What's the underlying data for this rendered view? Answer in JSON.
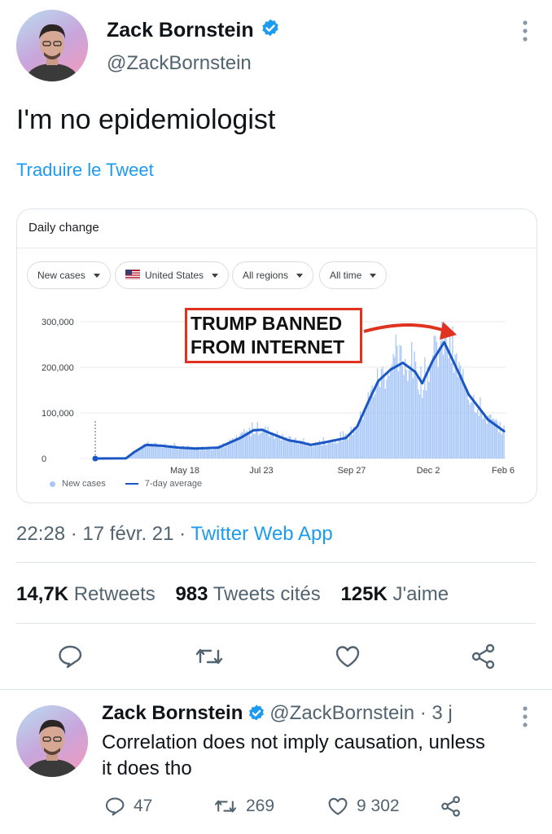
{
  "tweet": {
    "author_name": "Zack Bornstein",
    "author_handle": "@ZackBornstein",
    "text": "I'm no epidemiologist",
    "translate_label": "Traduire le Tweet",
    "time": "22:28",
    "date": "17 févr. 21",
    "source": "Twitter Web App",
    "sep1": "·",
    "sep2": "·",
    "stats": {
      "retweets_count": "14,7K",
      "retweets_label": "Retweets",
      "quotes_count": "983",
      "quotes_label": "Tweets cités",
      "likes_count": "125K",
      "likes_label": "J'aime"
    },
    "actions": [
      "reply-icon",
      "retweet-icon",
      "like-icon",
      "share-icon"
    ]
  },
  "embedded_chart": {
    "header": "Daily change",
    "filters": {
      "metric": "New cases",
      "country": "United States",
      "regions": "All regions",
      "time": "All time"
    },
    "annotation_line1": "TRUMP BANNED",
    "annotation_line2": "FROM INTERNET",
    "legend_bars": "New cases",
    "legend_line": "7-day average"
  },
  "chart_data": {
    "type": "bar",
    "series": [
      {
        "name": "New cases",
        "style": "bar"
      },
      {
        "name": "7-day average",
        "style": "line"
      }
    ],
    "x_tick_labels": [
      "May 18",
      "Jul 23",
      "Sep 27",
      "Dec 2",
      "Feb 6"
    ],
    "y_tick_labels": [
      "300,000",
      "200,000",
      "100,000",
      "0"
    ],
    "ylim": [
      0,
      300000
    ],
    "x_index_range": [
      0,
      390
    ],
    "x_tick_index": [
      117,
      183,
      250,
      316,
      382
    ],
    "avg_points": [
      [
        0,
        0
      ],
      [
        35,
        500
      ],
      [
        45,
        15000
      ],
      [
        58,
        30000
      ],
      [
        75,
        28000
      ],
      [
        95,
        24000
      ],
      [
        115,
        22000
      ],
      [
        140,
        24000
      ],
      [
        165,
        45000
      ],
      [
        180,
        62000
      ],
      [
        190,
        63000
      ],
      [
        200,
        55000
      ],
      [
        220,
        40000
      ],
      [
        235,
        35000
      ],
      [
        245,
        30000
      ],
      [
        260,
        35000
      ],
      [
        285,
        45000
      ],
      [
        298,
        70000
      ],
      [
        312,
        130000
      ],
      [
        322,
        170000
      ],
      [
        336,
        195000
      ],
      [
        350,
        210000
      ],
      [
        364,
        190000
      ],
      [
        372,
        165000
      ],
      [
        384,
        215000
      ],
      [
        397,
        255000
      ],
      [
        413,
        190000
      ],
      [
        425,
        140000
      ],
      [
        433,
        120000
      ],
      [
        447,
        85000
      ],
      [
        465,
        60000
      ]
    ],
    "avg_x_unit": "index-scaled",
    "bar_noise_note": "daily bars roughly follow 7-day average with spikes",
    "annotation_target": {
      "x": 398,
      "y": 255000
    },
    "colors": {
      "bars": "#a8c7f7",
      "line": "#1a56c4",
      "annotation": "#e0331f"
    }
  }
}
